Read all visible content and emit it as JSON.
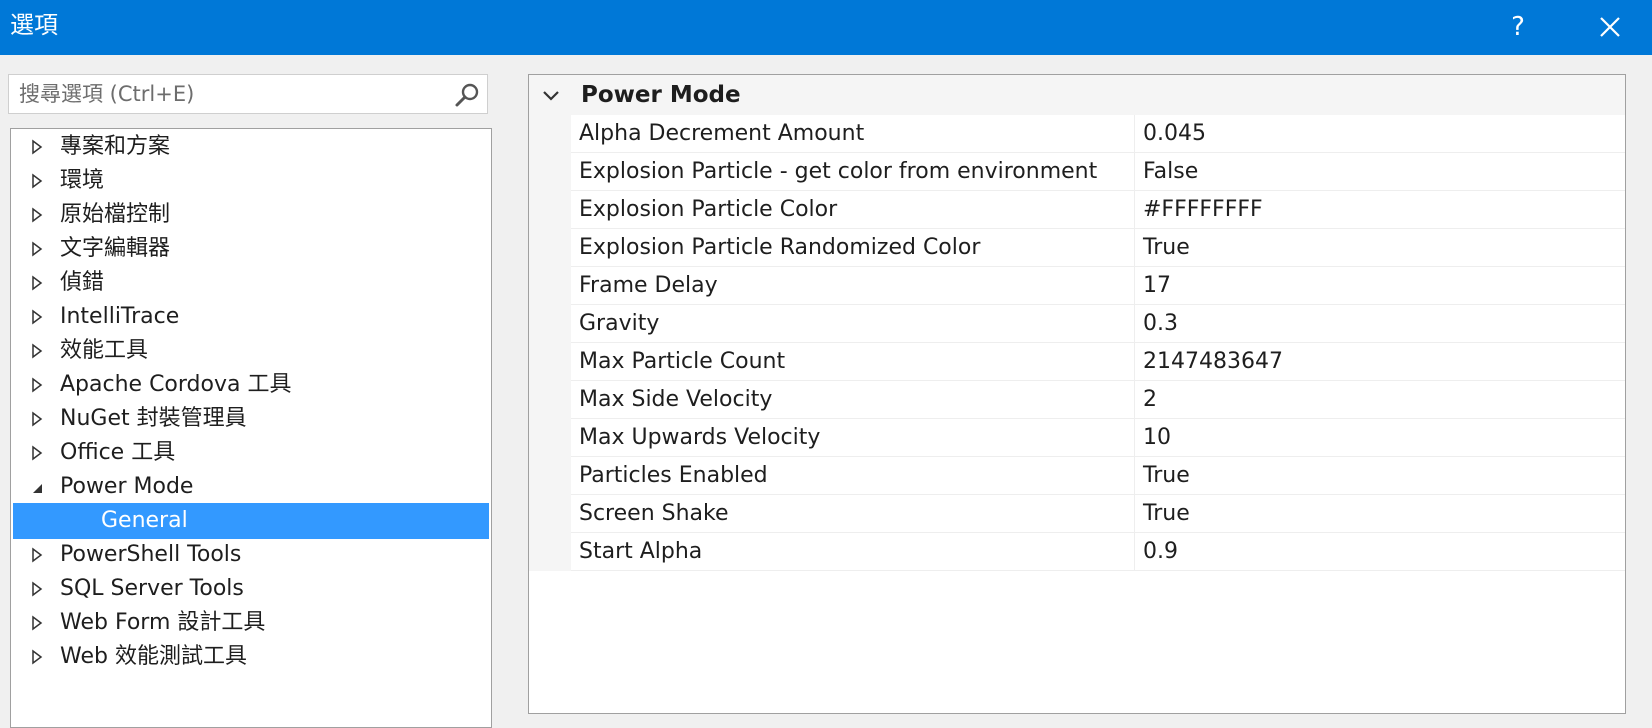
{
  "window": {
    "title": "選項",
    "help_label": "?",
    "close_label": "✕"
  },
  "search": {
    "placeholder": "搜尋選項 (Ctrl+E)",
    "value": ""
  },
  "tree": {
    "items": [
      {
        "label": "專案和方案",
        "expanded": false
      },
      {
        "label": "環境",
        "expanded": false
      },
      {
        "label": "原始檔控制",
        "expanded": false
      },
      {
        "label": "文字編輯器",
        "expanded": false
      },
      {
        "label": "偵錯",
        "expanded": false
      },
      {
        "label": "IntelliTrace",
        "expanded": false
      },
      {
        "label": "效能工具",
        "expanded": false
      },
      {
        "label": "Apache Cordova 工具",
        "expanded": false
      },
      {
        "label": "NuGet 封裝管理員",
        "expanded": false
      },
      {
        "label": "Office 工具",
        "expanded": false
      },
      {
        "label": "Power Mode",
        "expanded": true
      },
      {
        "label": "General",
        "child": true,
        "selected": true
      },
      {
        "label": "PowerShell Tools",
        "expanded": false
      },
      {
        "label": "SQL Server Tools",
        "expanded": false
      },
      {
        "label": "Web Form 設計工具",
        "expanded": false
      },
      {
        "label": "Web 效能測試工具",
        "expanded": false
      }
    ]
  },
  "property_grid": {
    "category": "Power Mode",
    "properties": [
      {
        "name": "Alpha Decrement Amount",
        "value": "0.045"
      },
      {
        "name": "Explosion Particle - get color from environment",
        "value": "False"
      },
      {
        "name": "Explosion Particle Color",
        "value": "#FFFFFFFF"
      },
      {
        "name": "Explosion Particle Randomized Color",
        "value": "True"
      },
      {
        "name": "Frame Delay",
        "value": "17"
      },
      {
        "name": "Gravity",
        "value": "0.3"
      },
      {
        "name": "Max Particle Count",
        "value": "2147483647"
      },
      {
        "name": "Max Side Velocity",
        "value": "2"
      },
      {
        "name": "Max Upwards Velocity",
        "value": "10"
      },
      {
        "name": "Particles Enabled",
        "value": "True"
      },
      {
        "name": "Screen Shake",
        "value": "True"
      },
      {
        "name": "Start Alpha",
        "value": "0.9"
      }
    ]
  },
  "colors": {
    "titlebar": "#0078d7",
    "selection": "#3399ff",
    "window_background": "#f0f0f0"
  }
}
